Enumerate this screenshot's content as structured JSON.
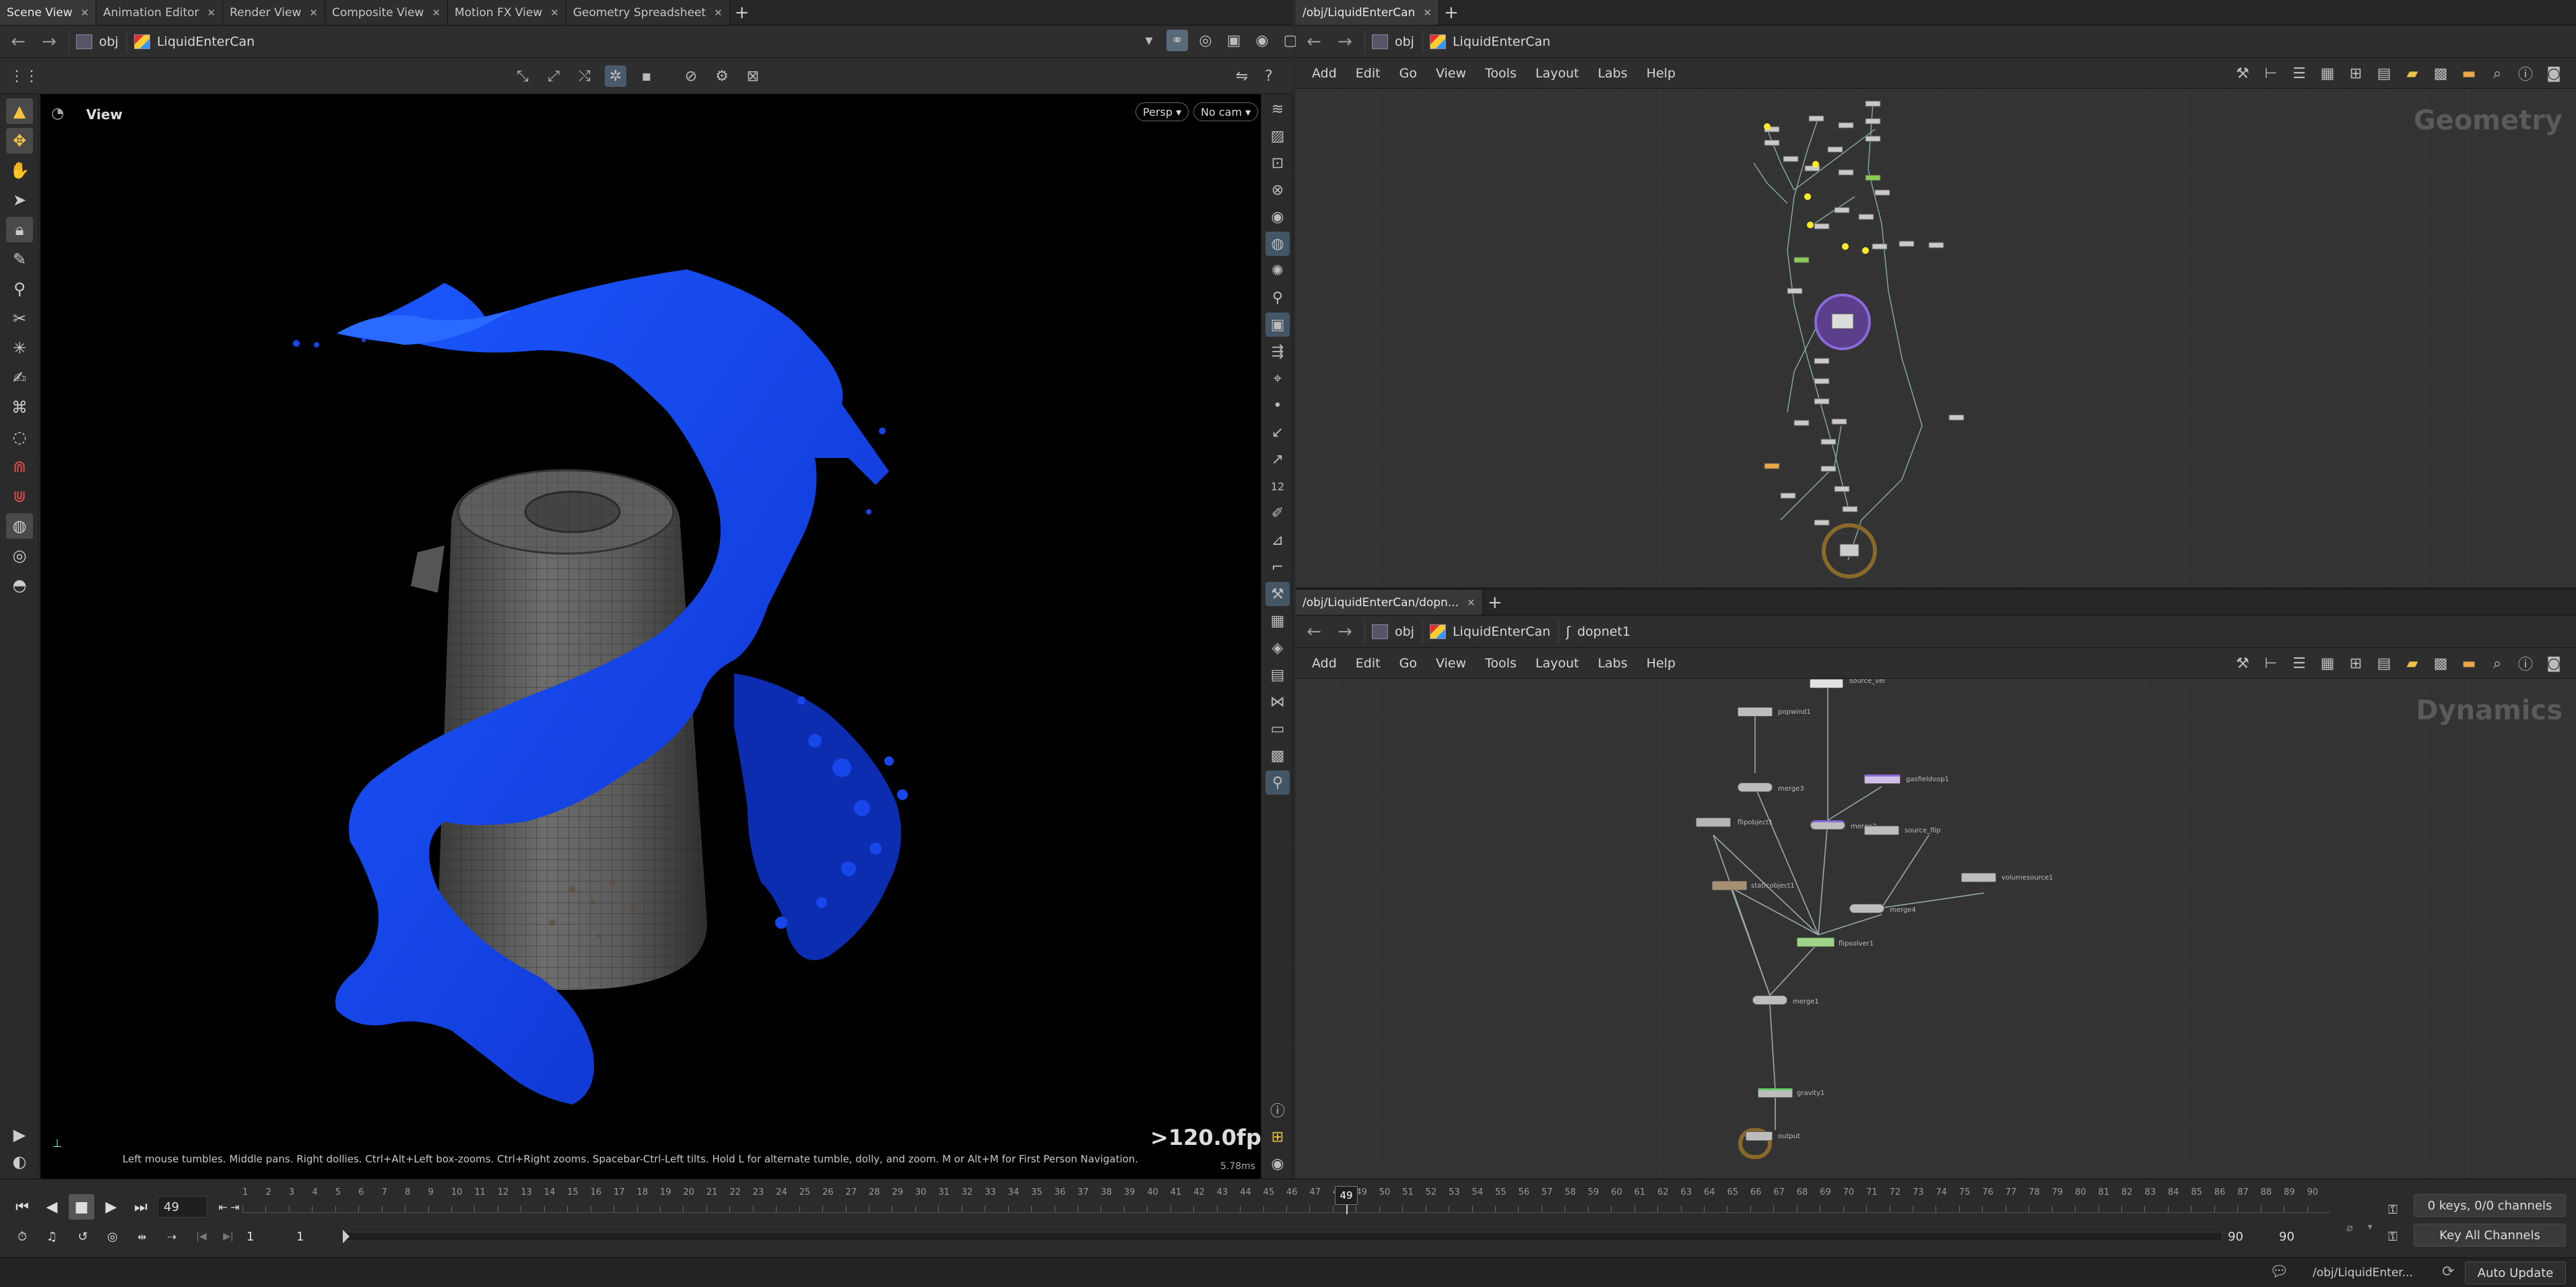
{
  "left_tabs": [
    {
      "label": "Scene View",
      "active": true
    },
    {
      "label": "Animation Editor"
    },
    {
      "label": "Render View"
    },
    {
      "label": "Composite View"
    },
    {
      "label": "Motion FX View"
    },
    {
      "label": "Geometry Spreadsheet"
    }
  ],
  "left_path": {
    "root": "obj",
    "node": "LiquidEnterCan"
  },
  "viewport": {
    "title": "View",
    "persp_label": "Persp",
    "cam_label": "No cam",
    "help_text": "Left mouse tumbles. Middle pans. Right dollies. Ctrl+Alt+Left box-zooms. Ctrl+Right zooms. Spacebar-Ctrl-Left tilts. Hold L for alternate tumble, dolly, and zoom. M or Alt+M for First Person Navigation.",
    "fps": ">120.0fps",
    "ms": "5.78ms",
    "fluid_color": "#1a4dff"
  },
  "top_right": {
    "tab": "/obj/LiquidEnterCan",
    "path_root": "obj",
    "path_node": "LiquidEnterCan",
    "context": "Geometry"
  },
  "bottom_right": {
    "tab": "/obj/LiquidEnterCan/dopn...",
    "path_root": "obj",
    "path_node": "LiquidEnterCan",
    "path_sub": "dopnet1",
    "context": "Dynamics",
    "nodes": [
      {
        "name": "source_vel"
      },
      {
        "name": "popwind1"
      },
      {
        "name": "merge3"
      },
      {
        "name": "gasfieldvop1"
      },
      {
        "name": "flipobject1"
      },
      {
        "name": "merge2"
      },
      {
        "name": "source_flip"
      },
      {
        "name": "staticobject1"
      },
      {
        "name": "volumesource1"
      },
      {
        "name": "merge4"
      },
      {
        "name": "flipsolver1"
      },
      {
        "name": "merge1"
      },
      {
        "name": "gravity1"
      },
      {
        "name": "output"
      }
    ]
  },
  "menus": [
    "Add",
    "Edit",
    "Go",
    "View",
    "Tools",
    "Layout",
    "Labs",
    "Help"
  ],
  "timeline": {
    "frame": "49",
    "start": "1",
    "start2": "1",
    "end": "90",
    "end2": "90",
    "keys_label": "0 keys, 0/0 channels",
    "key_all": "Key All Channels",
    "status_path": "/obj/LiquidEnter...",
    "auto_update": "Auto Update",
    "ticks": [
      "1",
      "2",
      "3",
      "4",
      "5",
      "6",
      "7",
      "8",
      "9",
      "10",
      "11",
      "12",
      "13",
      "14",
      "15",
      "16",
      "17",
      "18",
      "19",
      "20",
      "21",
      "22",
      "23",
      "24",
      "25",
      "26",
      "27",
      "28",
      "29",
      "30",
      "31",
      "32",
      "33",
      "34",
      "35",
      "36",
      "37",
      "38",
      "39",
      "40",
      "41",
      "42",
      "43",
      "44",
      "45",
      "46",
      "47",
      "48",
      "49",
      "50",
      "51",
      "52",
      "53",
      "54",
      "55",
      "56",
      "57",
      "58",
      "59",
      "60",
      "61",
      "62",
      "63",
      "64",
      "65",
      "66",
      "67",
      "68",
      "69",
      "70",
      "71",
      "72",
      "73",
      "74",
      "75",
      "76",
      "77",
      "78",
      "79",
      "80",
      "81",
      "82",
      "83",
      "84",
      "85",
      "86",
      "87",
      "88",
      "89",
      "90"
    ]
  }
}
